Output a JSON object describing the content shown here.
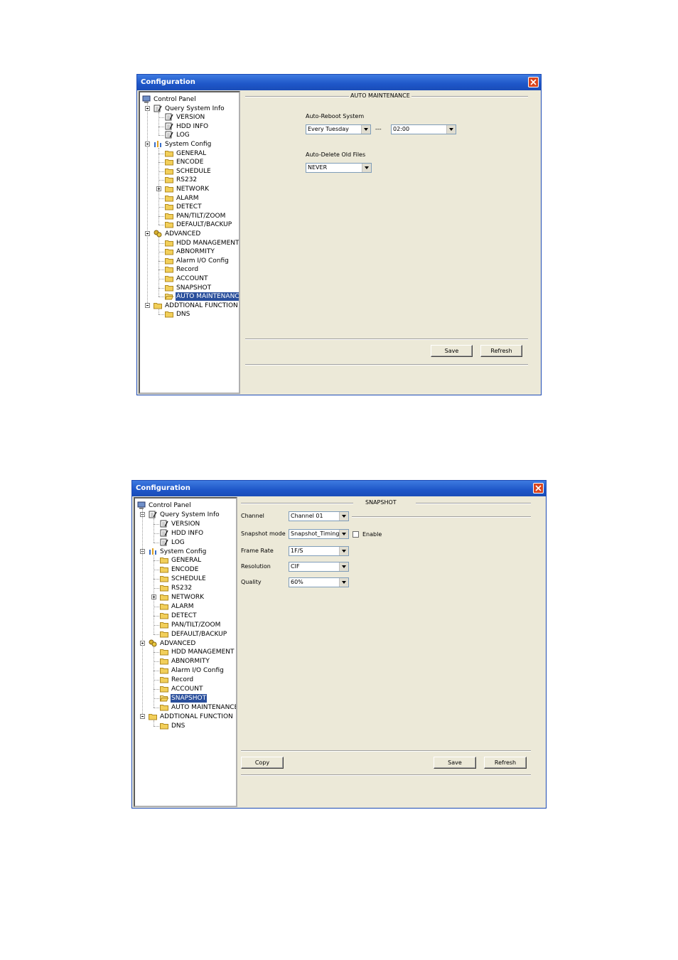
{
  "window1": {
    "title": "Configuration",
    "tree": [
      {
        "id": "control",
        "label": "Control Panel",
        "icon": "monitor-icon"
      },
      {
        "id": "query",
        "label": "Query System Info",
        "icon": "edit-icon"
      },
      {
        "id": "version",
        "label": "VERSION",
        "icon": "edit-icon"
      },
      {
        "id": "hdd",
        "label": "HDD INFO",
        "icon": "edit-icon"
      },
      {
        "id": "log",
        "label": "LOG",
        "icon": "edit-icon"
      },
      {
        "id": "sysconfig",
        "label": "System Config",
        "icon": "config-icon"
      },
      {
        "id": "general",
        "label": "GENERAL",
        "icon": "folder-icon"
      },
      {
        "id": "encode",
        "label": "ENCODE",
        "icon": "folder-icon"
      },
      {
        "id": "schedule",
        "label": "SCHEDULE",
        "icon": "folder-icon"
      },
      {
        "id": "rs232",
        "label": "RS232",
        "icon": "folder-icon"
      },
      {
        "id": "network",
        "label": "NETWORK",
        "icon": "folder-icon"
      },
      {
        "id": "alarm",
        "label": "ALARM",
        "icon": "folder-icon"
      },
      {
        "id": "detect",
        "label": "DETECT",
        "icon": "folder-icon"
      },
      {
        "id": "ptz",
        "label": "PAN/TILT/ZOOM",
        "icon": "folder-icon"
      },
      {
        "id": "default",
        "label": "DEFAULT/BACKUP",
        "icon": "folder-icon"
      },
      {
        "id": "advanced",
        "label": "ADVANCED",
        "icon": "advanced-icon"
      },
      {
        "id": "hddmgmt",
        "label": "HDD MANAGEMENT",
        "icon": "folder-icon"
      },
      {
        "id": "abnormity",
        "label": "ABNORMITY",
        "icon": "folder-icon"
      },
      {
        "id": "alarmio",
        "label": "Alarm I/O Config",
        "icon": "folder-icon"
      },
      {
        "id": "record",
        "label": "Record",
        "icon": "folder-icon"
      },
      {
        "id": "account",
        "label": "ACCOUNT",
        "icon": "folder-icon"
      },
      {
        "id": "snapshot",
        "label": "SNAPSHOT",
        "icon": "folder-icon"
      },
      {
        "id": "automaint",
        "label": "AUTO MAINTENANCE",
        "icon": "folder-open-icon"
      },
      {
        "id": "additional",
        "label": "ADDTIONAL FUNCTION",
        "icon": "folder-icon"
      },
      {
        "id": "dns",
        "label": "DNS",
        "icon": "folder-icon"
      }
    ],
    "section_title": "AUTO MAINTENANCE",
    "reboot_label": "Auto-Reboot System",
    "reboot_day": "Every Tuesday",
    "reboot_sep": "---",
    "reboot_time": "02:00",
    "delete_label": "Auto-Delete Old Files",
    "delete_value": "NEVER",
    "save": "Save",
    "refresh": "Refresh"
  },
  "window2": {
    "title": "Configuration",
    "tree": [
      {
        "id": "control",
        "label": "Control Panel",
        "icon": "monitor-icon"
      },
      {
        "id": "query",
        "label": "Query System Info",
        "icon": "edit-icon"
      },
      {
        "id": "version",
        "label": "VERSION",
        "icon": "edit-icon"
      },
      {
        "id": "hdd",
        "label": "HDD INFO",
        "icon": "edit-icon"
      },
      {
        "id": "log",
        "label": "LOG",
        "icon": "edit-icon"
      },
      {
        "id": "sysconfig",
        "label": "System Config",
        "icon": "config-icon"
      },
      {
        "id": "general",
        "label": "GENERAL",
        "icon": "folder-icon"
      },
      {
        "id": "encode",
        "label": "ENCODE",
        "icon": "folder-icon"
      },
      {
        "id": "schedule",
        "label": "SCHEDULE",
        "icon": "folder-icon"
      },
      {
        "id": "rs232",
        "label": "RS232",
        "icon": "folder-icon"
      },
      {
        "id": "network",
        "label": "NETWORK",
        "icon": "folder-icon"
      },
      {
        "id": "alarm",
        "label": "ALARM",
        "icon": "folder-icon"
      },
      {
        "id": "detect",
        "label": "DETECT",
        "icon": "folder-icon"
      },
      {
        "id": "ptz",
        "label": "PAN/TILT/ZOOM",
        "icon": "folder-icon"
      },
      {
        "id": "default",
        "label": "DEFAULT/BACKUP",
        "icon": "folder-icon"
      },
      {
        "id": "advanced",
        "label": "ADVANCED",
        "icon": "advanced-icon"
      },
      {
        "id": "hddmgmt",
        "label": "HDD MANAGEMENT",
        "icon": "folder-icon"
      },
      {
        "id": "abnormity",
        "label": "ABNORMITY",
        "icon": "folder-icon"
      },
      {
        "id": "alarmio",
        "label": "Alarm I/O Config",
        "icon": "folder-icon"
      },
      {
        "id": "record",
        "label": "Record",
        "icon": "folder-icon"
      },
      {
        "id": "account",
        "label": "ACCOUNT",
        "icon": "folder-icon"
      },
      {
        "id": "snapshot",
        "label": "SNAPSHOT",
        "icon": "folder-open-icon"
      },
      {
        "id": "automaint",
        "label": "AUTO MAINTENANCE",
        "icon": "folder-icon"
      },
      {
        "id": "additional",
        "label": "ADDTIONAL FUNCTION",
        "icon": "folder-icon"
      },
      {
        "id": "dns",
        "label": "DNS",
        "icon": "folder-icon"
      }
    ],
    "section_title": "SNAPSHOT",
    "channel_label": "Channel",
    "channel_value": "Channel 01",
    "mode_label": "Snapshot mode",
    "mode_value": "Snapshot_Timing",
    "enable_label": "Enable",
    "framerate_label": "Frame Rate",
    "framerate_value": "1F/S",
    "resolution_label": "Resolution",
    "resolution_value": "CIF",
    "quality_label": "Quality",
    "quality_value": "60%",
    "copy": "Copy",
    "save": "Save",
    "refresh": "Refresh"
  }
}
